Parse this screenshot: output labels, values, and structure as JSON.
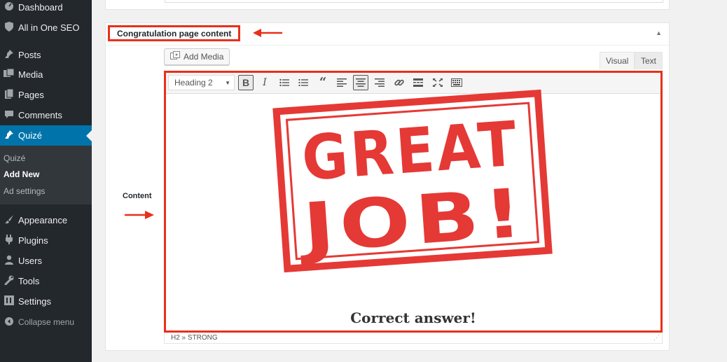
{
  "sidebar": {
    "items": [
      {
        "label": "Dashboard",
        "icon": "dashboard-icon"
      },
      {
        "label": "All in One SEO",
        "icon": "shield-icon"
      },
      {
        "label": "Posts",
        "icon": "pin-icon"
      },
      {
        "label": "Media",
        "icon": "media-icon"
      },
      {
        "label": "Pages",
        "icon": "pages-icon"
      },
      {
        "label": "Comments",
        "icon": "comments-icon"
      },
      {
        "label": "Quizé",
        "icon": "pin-icon",
        "active": true
      },
      {
        "label": "Appearance",
        "icon": "brush-icon"
      },
      {
        "label": "Plugins",
        "icon": "plugins-icon"
      },
      {
        "label": "Users",
        "icon": "users-icon"
      },
      {
        "label": "Tools",
        "icon": "wrench-icon"
      },
      {
        "label": "Settings",
        "icon": "settings-icon"
      }
    ],
    "submenu": [
      "Quizé",
      "Add New",
      "Ad settings"
    ],
    "collapse_label": "Collapse menu"
  },
  "postbox": {
    "title": "Congratulation page content",
    "field_label": "Content"
  },
  "editor": {
    "add_media_label": "Add Media",
    "tabs": [
      "Visual",
      "Text"
    ],
    "format_select": "Heading 2",
    "stamp_image": {
      "line1": "GREAT",
      "line2": "JOB!"
    },
    "caption": "Correct answer!",
    "path": "H2 » STRONG"
  },
  "colors": {
    "sidebar_bg": "#23282d",
    "active_bg": "#0073aa",
    "highlight_red": "#e8301a",
    "stamp_red": "#e53935"
  }
}
